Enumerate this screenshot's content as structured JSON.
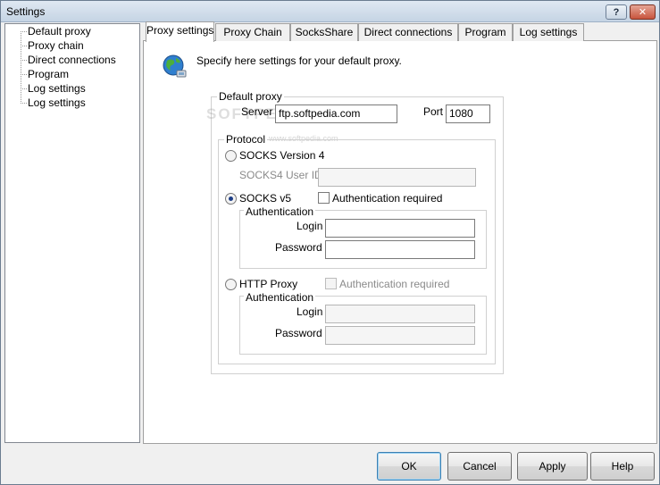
{
  "window": {
    "title": "Settings",
    "help_glyph": "?",
    "close_glyph": "✕"
  },
  "tree": {
    "items": [
      "Default proxy",
      "Proxy chain",
      "Direct connections",
      "Program",
      "Log settings",
      "Log settings"
    ]
  },
  "tabs": [
    "Proxy settings",
    "Proxy Chain",
    "SocksShare",
    "Direct connections",
    "Program",
    "Log settings"
  ],
  "active_tab": 0,
  "panel": {
    "icon": "globe-network-icon",
    "description": "Specify here settings for your default proxy.",
    "default_proxy": {
      "group_label": "Default proxy",
      "server_label": "Server",
      "server_value": "ftp.softpedia.com",
      "port_label": "Port",
      "port_value": "1080"
    },
    "protocol": {
      "group_label": "Protocol",
      "socks4_label": "SOCKS Version 4",
      "socks4_userid_label": "SOCKS4 User ID",
      "socks4_userid_value": "",
      "socks5_label": "SOCKS v5",
      "socks5_auth_label": "Authentication required",
      "socks5_auth_group": "Authentication",
      "socks5_login_label": "Login",
      "socks5_login_value": "",
      "socks5_password_label": "Password",
      "socks5_password_value": "",
      "http_label": "HTTP Proxy",
      "http_auth_label": "Authentication required",
      "http_auth_group": "Authentication",
      "http_login_label": "Login",
      "http_login_value": "",
      "http_password_label": "Password",
      "http_password_value": "",
      "selected": "SOCKS v5"
    },
    "watermark": "SOFTPEDIA",
    "watermark_url": "www.softpedia.com"
  },
  "buttons": {
    "ok": "OK",
    "cancel": "Cancel",
    "apply": "Apply",
    "help": "Help"
  },
  "colors": {
    "radio_dot": "#1e3e86",
    "close_button": "#c8543d",
    "default_button_border": "#3c7fb1"
  }
}
